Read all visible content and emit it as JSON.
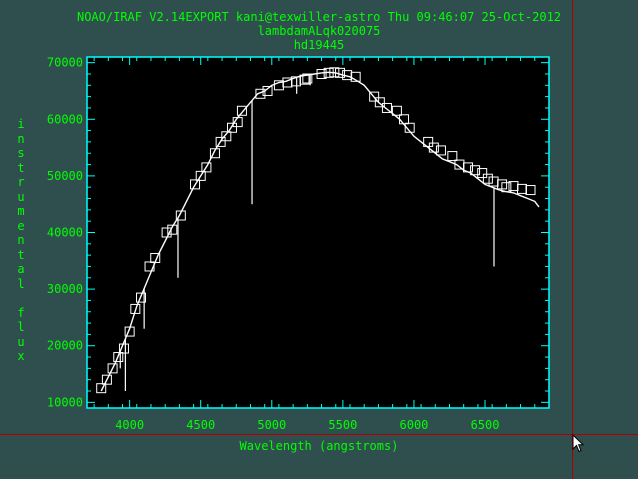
{
  "header": {
    "line1": "NOAO/IRAF V2.14EXPORT kani@texwiller-astro Thu 09:46:07 25-Oct-2012",
    "line2": "lambdamALqk020075",
    "line3": "hd19445"
  },
  "colors": {
    "background": "#2f4f4f",
    "plot_background": "#000000",
    "axes": "#00ffff",
    "text": "#00ff00",
    "spectrum": "#ffffff",
    "crosshair": "#b00000"
  },
  "cursor": {
    "icon": "arrow-pointer-icon"
  },
  "chart_data": {
    "type": "line",
    "title": "lambdamALqk020075",
    "subtitle": "hd19445",
    "xlabel": "Wavelength (angstroms)",
    "ylabel": "instrumental flux",
    "xlim": [
      3700,
      6950
    ],
    "ylim": [
      9000,
      71000
    ],
    "xticks": [
      4000,
      4500,
      5000,
      5500,
      6000,
      6500
    ],
    "yticks": [
      10000,
      20000,
      30000,
      40000,
      50000,
      60000,
      70000
    ],
    "xtick_labels": [
      "4000",
      "4500",
      "5000",
      "5500",
      "6000",
      "6500"
    ],
    "ytick_labels": [
      "10000",
      "20000",
      "30000",
      "40000",
      "50000",
      "60000",
      "70000"
    ],
    "grid": false,
    "series": [
      {
        "style": "line",
        "x": [
          3800,
          3850,
          3900,
          3950,
          4000,
          4050,
          4100,
          4150,
          4200,
          4250,
          4300,
          4350,
          4400,
          4450,
          4500,
          4550,
          4600,
          4650,
          4700,
          4750,
          4800,
          4850,
          4900,
          4950,
          5000,
          5050,
          5100,
          5150,
          5200,
          5250,
          5300,
          5350,
          5400,
          5450,
          5500,
          5550,
          5600,
          5650,
          5700,
          5750,
          5800,
          5850,
          5900,
          5950,
          6000,
          6050,
          6100,
          6150,
          6200,
          6250,
          6300,
          6350,
          6400,
          6450,
          6500,
          6550,
          6600,
          6650,
          6700,
          6750,
          6800,
          6850,
          6880
        ],
        "y": [
          12000,
          14500,
          17000,
          20000,
          23000,
          27000,
          30000,
          33000,
          36000,
          38500,
          41000,
          43000,
          45500,
          48000,
          50000,
          52000,
          54500,
          56500,
          58000,
          60000,
          61500,
          63000,
          64500,
          65000,
          66000,
          66500,
          66700,
          67200,
          67600,
          67800,
          68000,
          68200,
          68300,
          68200,
          67800,
          67500,
          66800,
          66000,
          64500,
          63000,
          62000,
          61000,
          60000,
          58500,
          57000,
          56000,
          55000,
          54000,
          53000,
          52500,
          52000,
          51000,
          50500,
          49500,
          48500,
          48000,
          47500,
          47200,
          47000,
          46500,
          46000,
          45500,
          44500
        ],
        "absorption_lines": [
          {
            "x": 3934,
            "y": 16000
          },
          {
            "x": 3970,
            "y": 12000
          },
          {
            "x": 4102,
            "y": 23000
          },
          {
            "x": 4340,
            "y": 32000
          },
          {
            "x": 4861,
            "y": 45000
          },
          {
            "x": 5175,
            "y": 64500
          },
          {
            "x": 5270,
            "y": 66000
          },
          {
            "x": 6563,
            "y": 34000
          }
        ]
      },
      {
        "style": "box-markers",
        "x": [
          3800,
          3840,
          3880,
          3920,
          3960,
          4000,
          4040,
          4080,
          4140,
          4180,
          4260,
          4300,
          4360,
          4460,
          4500,
          4540,
          4600,
          4640,
          4680,
          4720,
          4760,
          4790,
          4920,
          4970,
          5050,
          5110,
          5170,
          5230,
          5250,
          5350,
          5400,
          5440,
          5480,
          5530,
          5590,
          5720,
          5760,
          5810,
          5880,
          5930,
          5970,
          6100,
          6140,
          6190,
          6270,
          6320,
          6380,
          6430,
          6480,
          6520,
          6560,
          6620,
          6650,
          6700,
          6760,
          6820
        ],
        "y": [
          12500,
          14000,
          16000,
          18000,
          19500,
          22500,
          26500,
          28500,
          34000,
          35500,
          40000,
          40500,
          43000,
          48500,
          50000,
          51500,
          54000,
          56000,
          57000,
          58500,
          59500,
          61500,
          64500,
          65000,
          66000,
          66500,
          66700,
          67000,
          67200,
          68000,
          68200,
          68300,
          68200,
          67800,
          67500,
          64000,
          63000,
          62000,
          61500,
          60000,
          58500,
          56000,
          55000,
          54500,
          53500,
          52000,
          51500,
          51000,
          50500,
          49500,
          49000,
          48500,
          48000,
          48200,
          47700,
          47500
        ]
      }
    ]
  }
}
